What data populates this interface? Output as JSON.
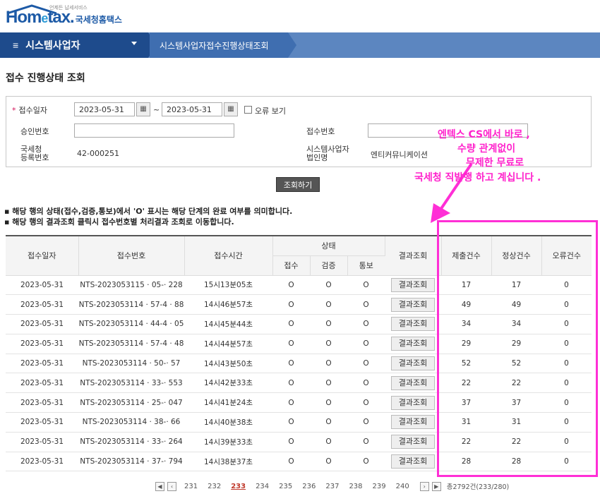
{
  "header": {
    "logo_main": "Hom",
    "logo_e": "e",
    "logo_rest": "tax",
    "logo_sub": "국세청홈택스",
    "logo_tagline": "언제든 납세서비스",
    "menu_label": "시스템사업자",
    "breadcrumb": "시스템사업자접수진행상태조회"
  },
  "page_title": "접수 진행상태 조회",
  "search": {
    "receipt_date_label": "접수일자",
    "date_from": "2023-05-31",
    "date_to": "2023-05-31",
    "range_sep": "~",
    "error_view_label": "오류 보기",
    "approval_no_label": "승인번호",
    "receipt_no_label": "접수번호",
    "reg_no_label_1": "국세청",
    "reg_no_label_2": "등록번호",
    "reg_no_value": "42-000251",
    "corp_name_label_1": "시스템사업자",
    "corp_name_label_2": "법인명",
    "corp_name_value": "엔티커뮤니케이션",
    "search_button": "조회하기"
  },
  "notes": [
    "▪ 해당 행의 상태(접수,검증,통보)에서 'O' 표시는 해당 단계의 완료 여부를 의미합니다.",
    "▪ 해당 행의 결과조회 클릭시 접수번호별 처리결과 조회로 이동합니다."
  ],
  "table": {
    "headers": {
      "date": "접수일자",
      "receipt_no": "접수번호",
      "time": "접수시간",
      "status": "상태",
      "status_receipt": "접수",
      "status_verify": "검증",
      "status_notify": "통보",
      "result": "결과조회",
      "submitted": "제출건수",
      "normal": "정상건수",
      "error": "오류건수"
    },
    "result_button": "결과조회",
    "rows": [
      {
        "date": "2023-05-31",
        "no": "NTS-2023053115 · 05-· 228",
        "time": "15시13분05초",
        "s1": "O",
        "s2": "O",
        "s3": "O",
        "submitted": "17",
        "normal": "17",
        "error": "0"
      },
      {
        "date": "2023-05-31",
        "no": "NTS-2023053114 · 57-4 · 88",
        "time": "14시46분57초",
        "s1": "O",
        "s2": "O",
        "s3": "O",
        "submitted": "49",
        "normal": "49",
        "error": "0"
      },
      {
        "date": "2023-05-31",
        "no": "NTS-2023053114 · 44-4 · 05",
        "time": "14시45분44초",
        "s1": "O",
        "s2": "O",
        "s3": "O",
        "submitted": "34",
        "normal": "34",
        "error": "0"
      },
      {
        "date": "2023-05-31",
        "no": "NTS-2023053114 · 57-4 · 48",
        "time": "14시44분57초",
        "s1": "O",
        "s2": "O",
        "s3": "O",
        "submitted": "29",
        "normal": "29",
        "error": "0"
      },
      {
        "date": "2023-05-31",
        "no": "NTS-2023053114 · 50-· 57",
        "time": "14시43분50초",
        "s1": "O",
        "s2": "O",
        "s3": "O",
        "submitted": "52",
        "normal": "52",
        "error": "0"
      },
      {
        "date": "2023-05-31",
        "no": "NTS-2023053114 · 33-· 553",
        "time": "14시42분33초",
        "s1": "O",
        "s2": "O",
        "s3": "O",
        "submitted": "22",
        "normal": "22",
        "error": "0"
      },
      {
        "date": "2023-05-31",
        "no": "NTS-2023053114 · 25-· 047",
        "time": "14시41분24초",
        "s1": "O",
        "s2": "O",
        "s3": "O",
        "submitted": "37",
        "normal": "37",
        "error": "0"
      },
      {
        "date": "2023-05-31",
        "no": "NTS-2023053114 · 38-· 66",
        "time": "14시40분38초",
        "s1": "O",
        "s2": "O",
        "s3": "O",
        "submitted": "31",
        "normal": "31",
        "error": "0"
      },
      {
        "date": "2023-05-31",
        "no": "NTS-2023053114 · 33-· 264",
        "time": "14시39분33초",
        "s1": "O",
        "s2": "O",
        "s3": "O",
        "submitted": "22",
        "normal": "22",
        "error": "0"
      },
      {
        "date": "2023-05-31",
        "no": "NTS-2023053114 · 37-· 794",
        "time": "14시38분37초",
        "s1": "O",
        "s2": "O",
        "s3": "O",
        "submitted": "28",
        "normal": "28",
        "error": "0"
      }
    ]
  },
  "pagination": {
    "pages": [
      "231",
      "232",
      "233",
      "234",
      "235",
      "236",
      "237",
      "238",
      "239",
      "240"
    ],
    "current": "233",
    "total": "총2792건(233/280)"
  },
  "annotation": {
    "lines": [
      "엔텍스 CS에서 바로 ,",
      "수량 관계없이",
      "무제한 무료로",
      "국세청 직발행 하고 계십니다 ."
    ],
    "color": "#ff22cc"
  }
}
